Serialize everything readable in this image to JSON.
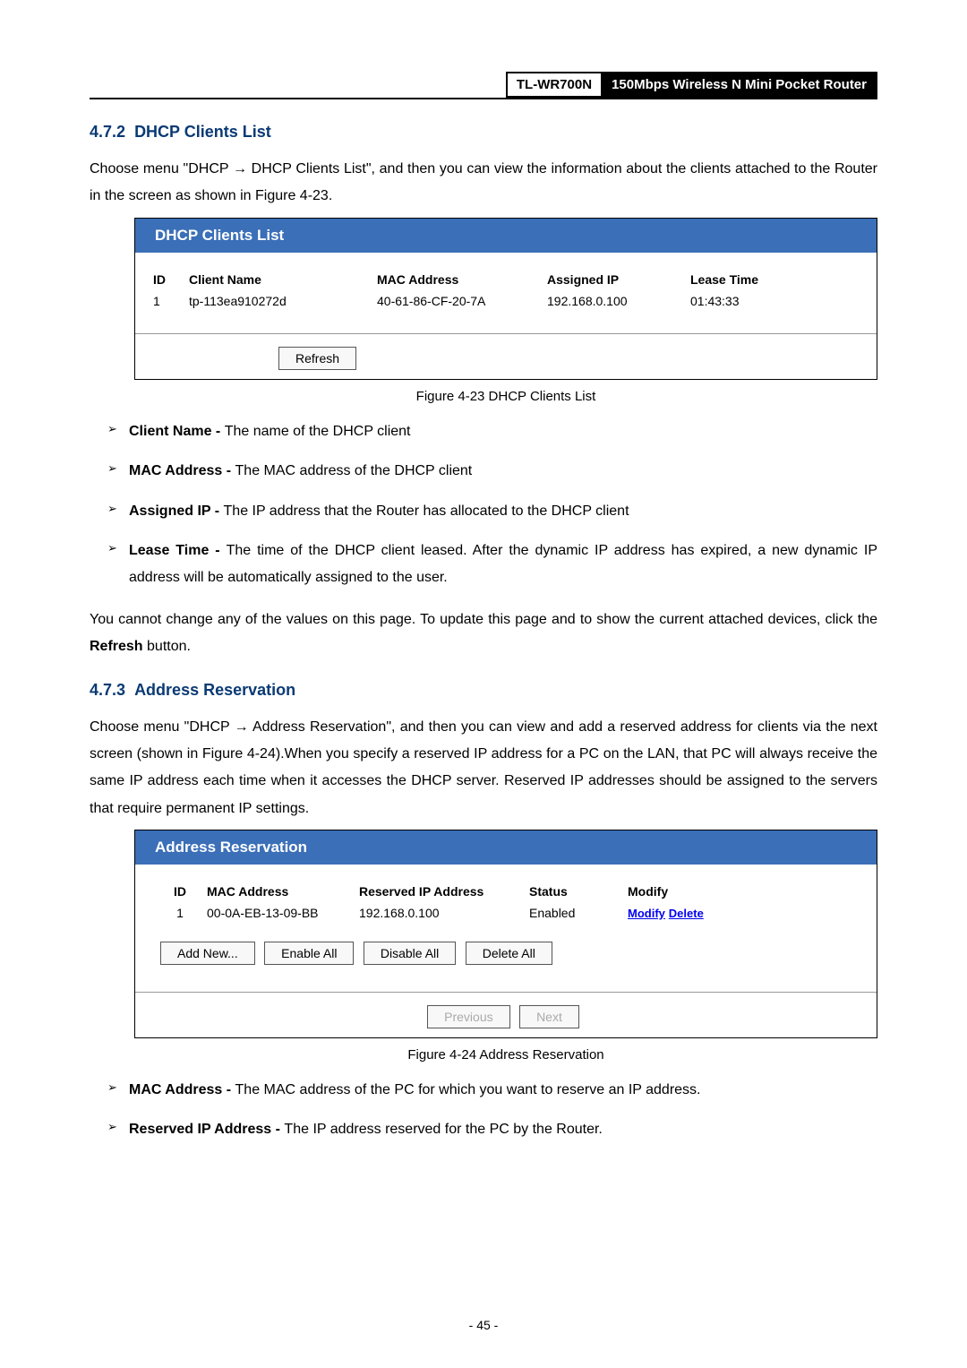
{
  "header": {
    "model": "TL-WR700N",
    "desc": "150Mbps Wireless N Mini Pocket Router"
  },
  "section1": {
    "number": "4.7.2",
    "title": "DHCP Clients List",
    "intro": "Choose menu \"DHCP → DHCP Clients List\", and then you can view the information about the clients attached to the Router in the screen as shown in Figure 4-23."
  },
  "figure1": {
    "panel_title": "DHCP Clients List",
    "headers": {
      "id": "ID",
      "client": "Client Name",
      "mac": "MAC Address",
      "ip": "Assigned IP",
      "lease": "Lease Time"
    },
    "rows": [
      {
        "id": "1",
        "client": "tp-113ea910272d",
        "mac": "40-61-86-CF-20-7A",
        "ip": "192.168.0.100",
        "lease": "01:43:33"
      }
    ],
    "refresh": "Refresh",
    "caption": "Figure 4-23 DHCP Clients List"
  },
  "bullets1": [
    {
      "term": "Client Name - ",
      "desc": "The name of the DHCP client"
    },
    {
      "term": "MAC Address - ",
      "desc": "The MAC address of the DHCP client"
    },
    {
      "term": "Assigned IP - ",
      "desc": "The IP address that the Router has allocated to the DHCP client"
    },
    {
      "term": "Lease Time - ",
      "desc": "The time of the DHCP client leased. After the dynamic IP address has expired, a new dynamic IP address will be automatically assigned to the user."
    }
  ],
  "note1": "You cannot change any of the values on this page. To update this page and to show the current attached devices, click the Refresh button.",
  "section2": {
    "number": "4.7.3",
    "title": "Address Reservation",
    "intro": "Choose menu \"DHCP → Address Reservation\", and then you can view and add a reserved address for clients via the next screen (shown in Figure 4-24).When you specify a reserved IP address for a PC on the LAN, that PC will always receive the same IP address each time when it accesses the DHCP server. Reserved IP addresses should be assigned to the servers that require permanent IP settings."
  },
  "figure2": {
    "panel_title": "Address Reservation",
    "headers": {
      "id": "ID",
      "mac": "MAC Address",
      "ip": "Reserved IP Address",
      "status": "Status",
      "modify": "Modify"
    },
    "rows": [
      {
        "id": "1",
        "mac": "00-0A-EB-13-09-BB",
        "ip": "192.168.0.100",
        "status": "Enabled",
        "modify": "Modify",
        "delete": "Delete"
      }
    ],
    "buttons": {
      "add": "Add New...",
      "enable": "Enable All",
      "disable": "Disable All",
      "delete": "Delete All",
      "prev": "Previous",
      "next": "Next"
    },
    "caption": "Figure 4-24 Address Reservation"
  },
  "bullets2": [
    {
      "term": "MAC Address - ",
      "desc": "The MAC address of the PC for which you want to reserve an IP address."
    },
    {
      "term": "Reserved IP Address - ",
      "desc": "The IP address reserved for the PC by the Router."
    }
  ],
  "page_number": "- 45 -"
}
